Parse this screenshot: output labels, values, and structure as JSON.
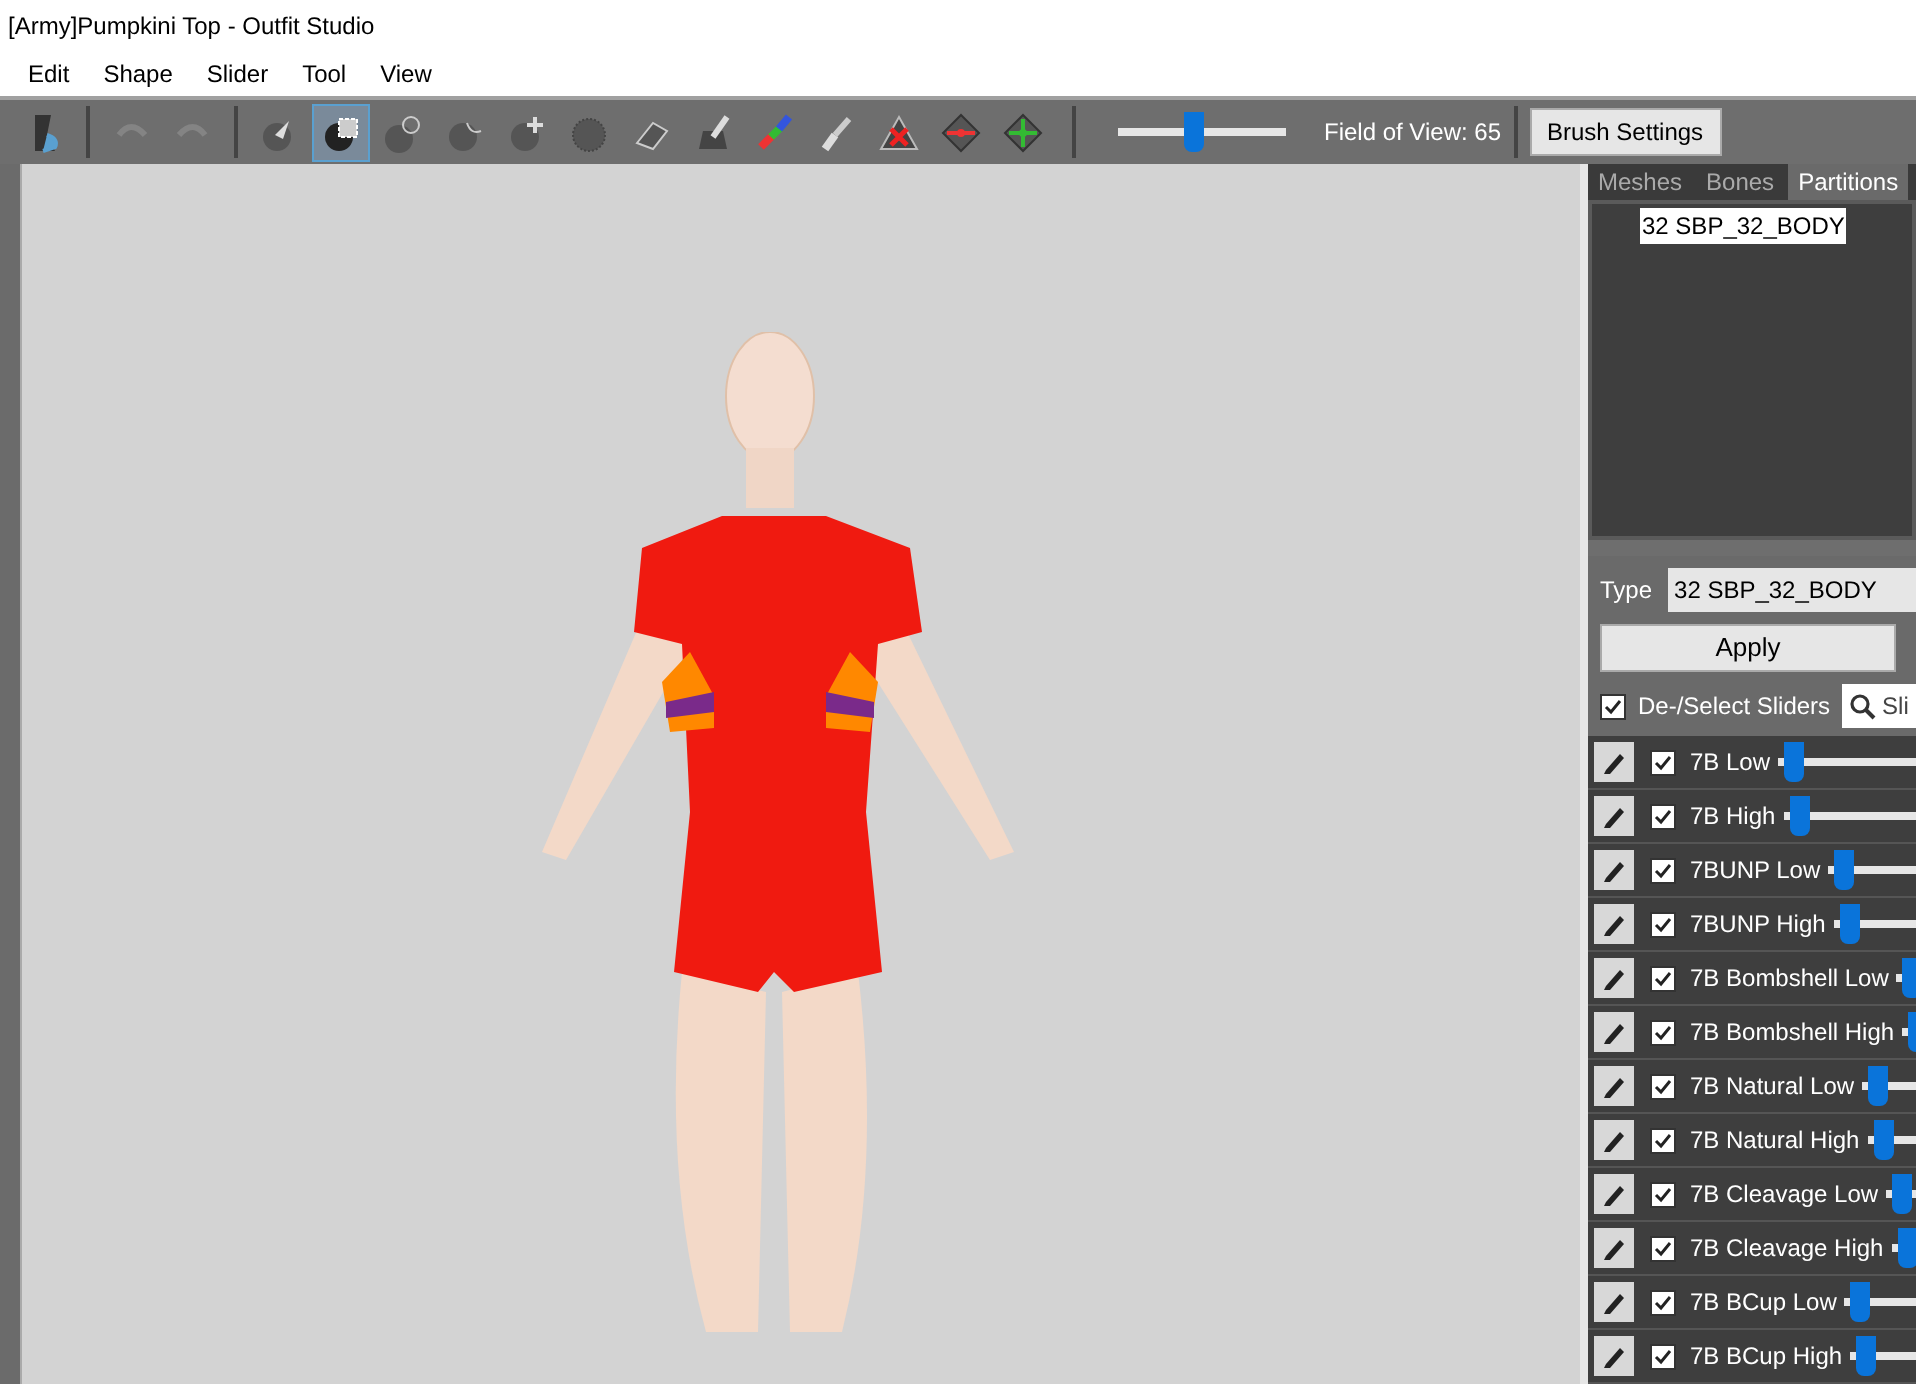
{
  "window": {
    "title": "[Army]Pumpkini Top - Outfit Studio"
  },
  "menu": [
    "Edit",
    "Shape",
    "Slider",
    "Tool",
    "View"
  ],
  "toolbar": {
    "tools": [
      {
        "kind": "mode",
        "selected": false,
        "disabled": false
      },
      {
        "kind": "undo",
        "selected": false,
        "disabled": true
      },
      {
        "kind": "redo",
        "selected": false,
        "disabled": true
      },
      {
        "kind": "select",
        "selected": false,
        "disabled": false
      },
      {
        "kind": "mask-select",
        "selected": true,
        "disabled": false
      },
      {
        "kind": "inflate",
        "selected": false,
        "disabled": false
      },
      {
        "kind": "deflate",
        "selected": false,
        "disabled": false
      },
      {
        "kind": "move",
        "selected": false,
        "disabled": false
      },
      {
        "kind": "smooth",
        "selected": false,
        "disabled": false
      },
      {
        "kind": "eraser",
        "selected": false,
        "disabled": false
      },
      {
        "kind": "mask-brush",
        "selected": false,
        "disabled": false
      },
      {
        "kind": "color-brush",
        "selected": false,
        "disabled": false
      },
      {
        "kind": "brush",
        "selected": false,
        "disabled": false
      },
      {
        "kind": "weight",
        "selected": false,
        "disabled": false
      },
      {
        "kind": "diamond-red",
        "selected": false,
        "disabled": false
      },
      {
        "kind": "diamond-green",
        "selected": false,
        "disabled": false
      }
    ],
    "fov_slider": {
      "level": 0.45
    },
    "fov_label": "Field of View: 65",
    "brush_settings": "Brush Settings"
  },
  "tabs": [
    {
      "label": "Meshes",
      "selected": false
    },
    {
      "label": "Bones",
      "selected": false
    },
    {
      "label": "Partitions",
      "selected": true
    }
  ],
  "partitions": [
    {
      "label": "32 SBP_32_BODY",
      "selected": true
    }
  ],
  "type_label": "Type",
  "type_value": "32 SBP_32_BODY",
  "apply": "Apply",
  "deselect": {
    "label": "De-/Select Sliders",
    "checked": true
  },
  "search": {
    "placeholder": "Sli"
  },
  "sliders": [
    {
      "name": "7B Low",
      "checked": true,
      "level": 0.02
    },
    {
      "name": "7B High",
      "checked": true,
      "level": 0.02
    },
    {
      "name": "7BUNP Low",
      "checked": true,
      "level": 0.02
    },
    {
      "name": "7BUNP High",
      "checked": true,
      "level": 0.02
    },
    {
      "name": "7B Bombshell Low",
      "checked": true,
      "level": 0.02
    },
    {
      "name": "7B Bombshell High",
      "checked": true,
      "level": 0.02
    },
    {
      "name": "7B Natural Low",
      "checked": true,
      "level": 0.02
    },
    {
      "name": "7B Natural High",
      "checked": true,
      "level": 0.02
    },
    {
      "name": "7B Cleavage Low",
      "checked": true,
      "level": 0.02
    },
    {
      "name": "7B Cleavage High",
      "checked": true,
      "level": 0.02
    },
    {
      "name": "7B BCup Low",
      "checked": true,
      "level": 0.02
    },
    {
      "name": "7B BCup High",
      "checked": true,
      "level": 0.02
    }
  ]
}
